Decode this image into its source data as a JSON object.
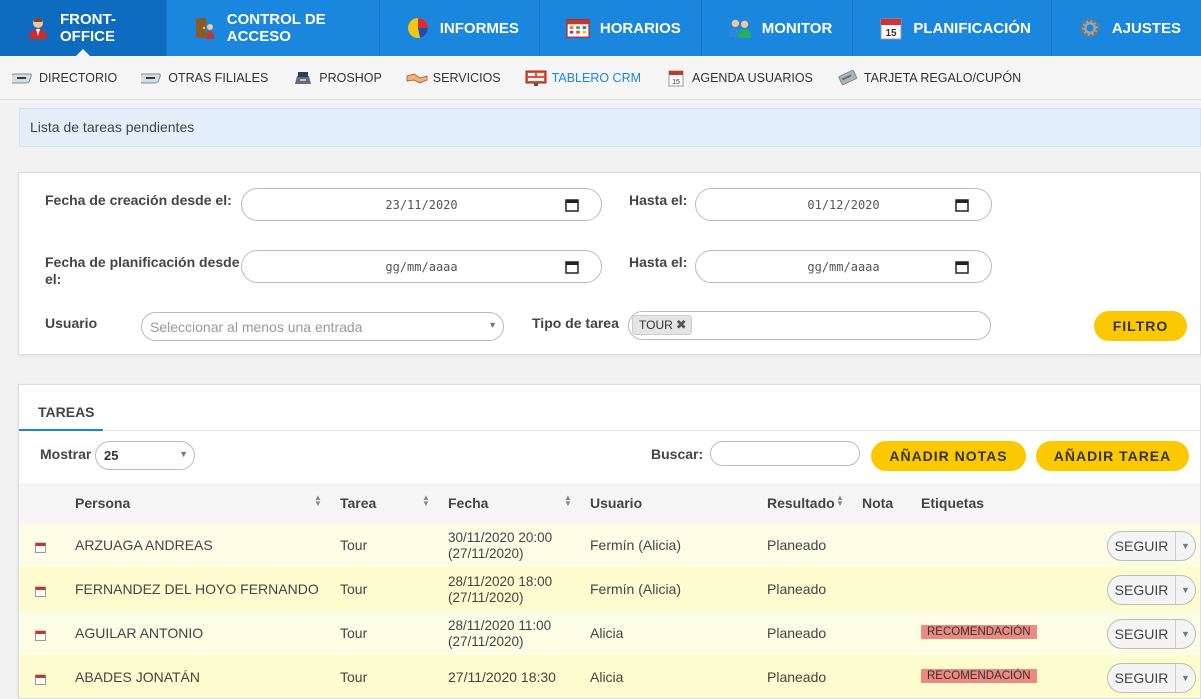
{
  "topnav": {
    "tabs": [
      {
        "label": "Front-Office",
        "icon": "user-icon",
        "active": true
      },
      {
        "label": "Control de acceso",
        "icon": "access-control-icon",
        "active": false
      },
      {
        "label": "Informes",
        "icon": "pie-chart-icon",
        "active": false
      },
      {
        "label": "Horarios",
        "icon": "schedule-icon",
        "active": false
      },
      {
        "label": "Monitor",
        "icon": "monitor-icon",
        "active": false
      },
      {
        "label": "Planificación",
        "icon": "calendar-icon",
        "active": false
      },
      {
        "label": "Ajustes",
        "icon": "gear-icon",
        "active": false
      }
    ]
  },
  "subnav": {
    "items": [
      {
        "label": "Directorio",
        "icon": "directory-icon"
      },
      {
        "label": "Otras filiales",
        "icon": "branches-icon"
      },
      {
        "label": "Proshop",
        "icon": "register-icon"
      },
      {
        "label": "Servicios",
        "icon": "handshake-icon"
      },
      {
        "label": "Tablero CRM",
        "icon": "crm-board-icon",
        "active": true
      },
      {
        "label": "Agenda usuarios",
        "icon": "agenda-icon"
      },
      {
        "label": "Tarjeta regalo/cupón",
        "icon": "gift-card-icon"
      }
    ]
  },
  "infobar": {
    "text": "Lista de tareas pendientes"
  },
  "filter": {
    "creation_from_label": "Fecha de creación desde el:",
    "creation_from_value": "23/11/2020",
    "creation_to_label": "Hasta el:",
    "creation_to_value": "01/12/2020",
    "plan_from_label_1": "Fecha de planificación desde",
    "plan_from_label_2": "el:",
    "plan_from_value": "gg/mm/aaaa",
    "plan_to_label": "Hasta el:",
    "plan_to_value": "gg/mm/aaaa",
    "user_label": "Usuario",
    "user_placeholder": "Seleccionar al menos una entrada",
    "type_label": "Tipo de tarea",
    "type_tag": "Tour",
    "filter_button": "Filtro"
  },
  "tareas": {
    "title": "Tareas",
    "show_label": "Mostrar",
    "show_value": "25",
    "search_label": "Buscar:",
    "add_notes_button": "Añadir notas",
    "add_task_button": "Añadir tarea",
    "columns": {
      "persona": "Persona",
      "tarea": "Tarea",
      "fecha": "Fecha",
      "usuario": "Usuario",
      "resultado": "Resultado",
      "nota": "Nota",
      "etiquetas": "Etiquetas"
    },
    "rows": [
      {
        "persona": "ARZUAGA ANDREAS",
        "tarea": "Tour",
        "fecha1": "30/11/2020 20:00",
        "fecha2": "(27/11/2020)",
        "usuario": "Fermín (Alicia)",
        "resultado": "Planeado",
        "etiqueta": "",
        "action": "Seguir"
      },
      {
        "persona": "FERNANDEZ DEL HOYO FERNANDO",
        "tarea": "Tour",
        "fecha1": "28/11/2020 18:00",
        "fecha2": "(27/11/2020)",
        "usuario": "Fermín (Alicia)",
        "resultado": "Planeado",
        "etiqueta": "",
        "action": "Seguir"
      },
      {
        "persona": "AGUILAR ANTONIO",
        "tarea": "Tour",
        "fecha1": "28/11/2020 11:00",
        "fecha2": "(27/11/2020)",
        "usuario": "Alicia",
        "resultado": "Planeado",
        "etiqueta": "Recomendación",
        "action": "Seguir"
      },
      {
        "persona": "ABADES JONATÁN",
        "tarea": "Tour",
        "fecha1": "27/11/2020 18:30",
        "fecha2": "",
        "usuario": "Alicia",
        "resultado": "Planeado",
        "etiqueta": "Recomendación",
        "action": "Seguir"
      }
    ]
  },
  "colors": {
    "nav_blue": "#1a86dd",
    "button_yellow": "#fcc800",
    "badge_red": "#ec8a82",
    "row_yellow": "#fcfcce"
  }
}
